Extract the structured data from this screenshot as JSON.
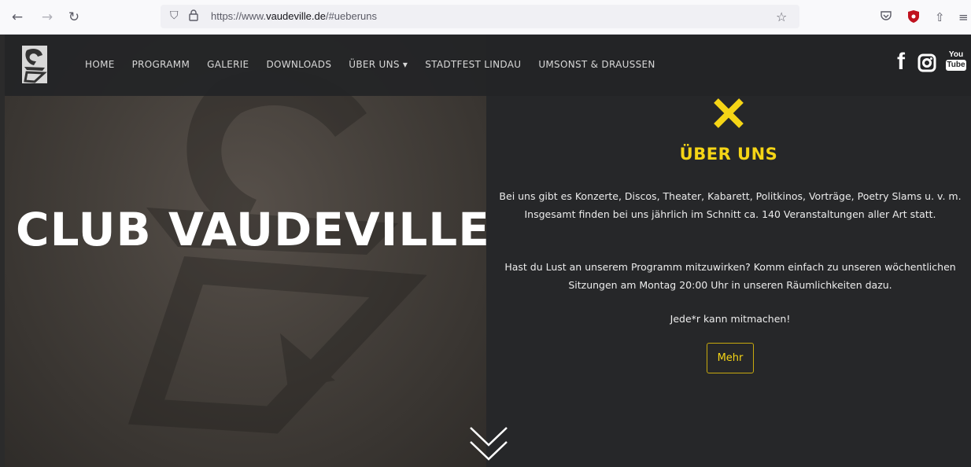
{
  "browser": {
    "url_prefix": "https://www.",
    "url_domain": "vaudeville.de",
    "url_suffix": "/#ueberuns",
    "icons": [
      "back-arrow-icon",
      "forward-arrow-icon",
      "reload-icon",
      "shield-icon",
      "lock-icon",
      "bookmark-star-icon",
      "pocket-icon",
      "ublock-icon",
      "share-icon",
      "menu-icon"
    ]
  },
  "nav": {
    "items": [
      "HOME",
      "PROGRAMM",
      "GALERIE",
      "DOWNLOADS",
      "ÜBER UNS",
      "STADTFEST LINDAU",
      "UMSONST & DRAUSSEN"
    ],
    "dropdown_caret": "▾",
    "social": {
      "facebook": "f",
      "youtube_top": "You",
      "youtube_bottom": "Tube"
    }
  },
  "hero": {
    "title": "CLUB VAUDEVILLE"
  },
  "about": {
    "title": "ÜBER UNS",
    "para1": "Bei uns gibt es Konzerte, Discos, Theater, Kabarett, Politkinos, Vorträge, Poetry Slams u. v. m. Insgesamt finden bei uns jährlich im Schnitt ca. 140 Veranstaltungen aller Art statt.",
    "para2": "Hast du Lust an unserem Programm mitzuwirken? Komm einfach zu unseren wöchentlichen Sitzungen am Montag 20:00 Uhr in unseren Räumlichkeiten dazu.",
    "para3": "Jede*r kann mitmachen!",
    "button": "Mehr"
  },
  "colors": {
    "accent": "#f5d516",
    "panel": "#262729",
    "text": "#ececec"
  }
}
